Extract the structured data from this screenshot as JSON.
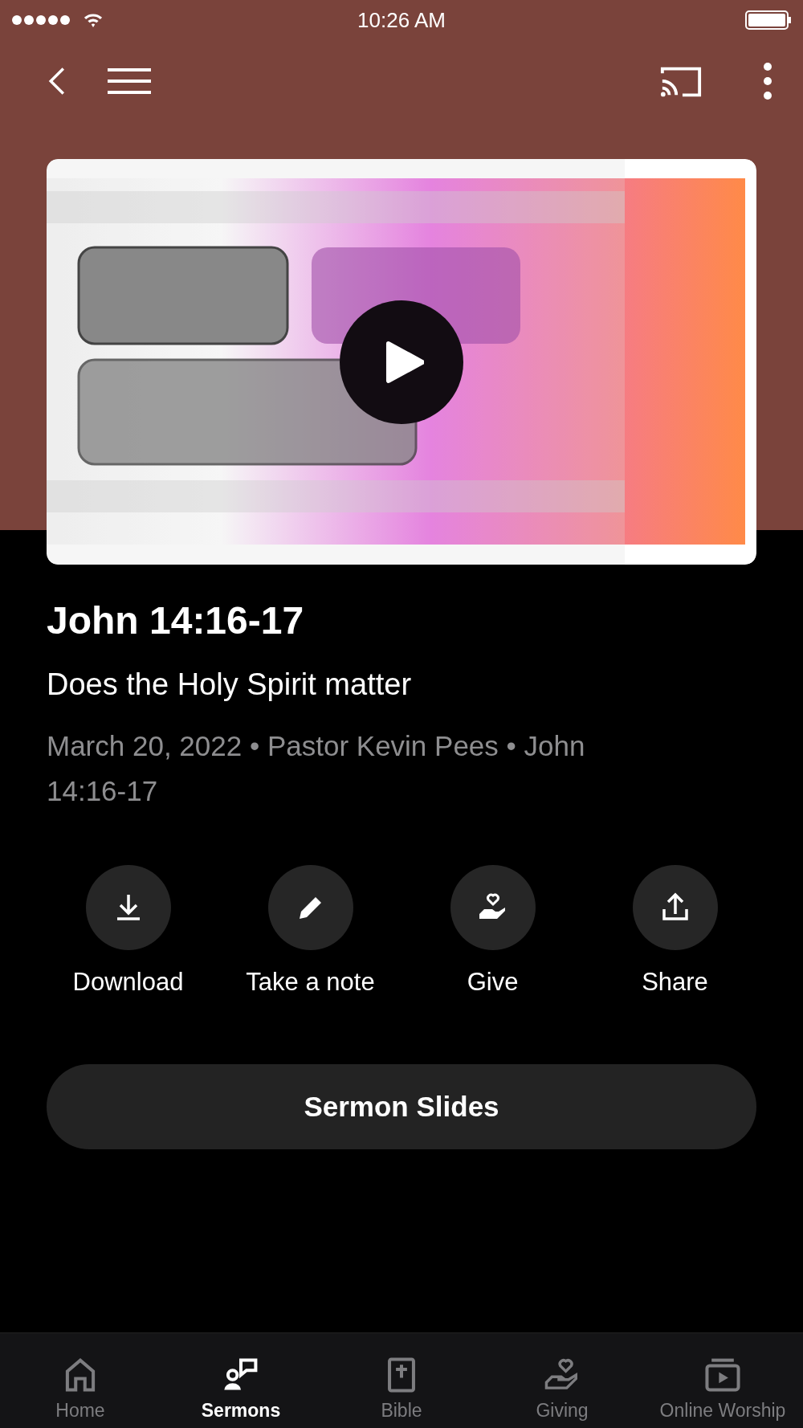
{
  "status_bar": {
    "time": "10:26 AM"
  },
  "sermon": {
    "title": "John 14:16-17",
    "subtitle": "Does the Holy Spirit matter",
    "meta": "March 20, 2022 • Pastor Kevin Pees • John 14:16-17"
  },
  "actions": [
    {
      "kind": "download",
      "label": "Download"
    },
    {
      "kind": "note",
      "label": "Take a note"
    },
    {
      "kind": "give",
      "label": "Give"
    },
    {
      "kind": "share",
      "label": "Share"
    }
  ],
  "slides_button": "Sermon Slides",
  "tabs": [
    {
      "kind": "home",
      "label": "Home",
      "selected": false
    },
    {
      "kind": "sermons",
      "label": "Sermons",
      "selected": true
    },
    {
      "kind": "bible",
      "label": "Bible",
      "selected": false
    },
    {
      "kind": "giving",
      "label": "Giving",
      "selected": false
    },
    {
      "kind": "worship",
      "label": "Online Worship",
      "selected": false
    }
  ]
}
